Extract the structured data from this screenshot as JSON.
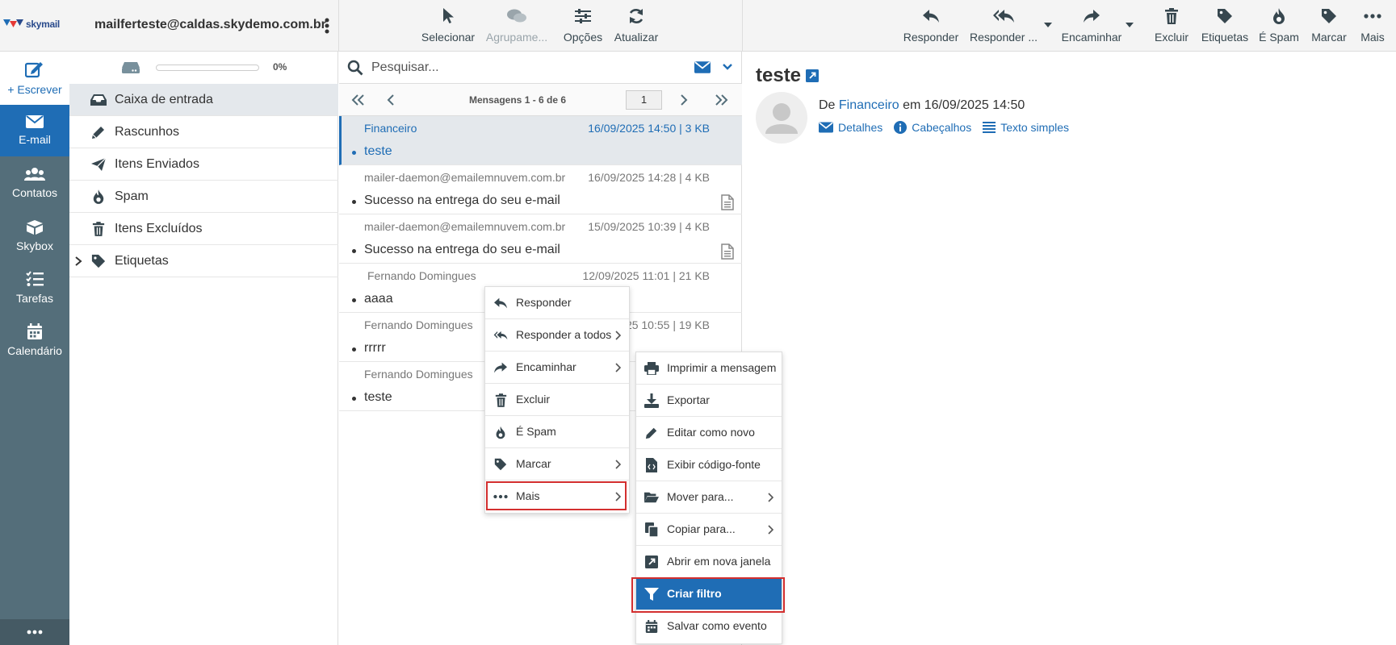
{
  "header": {
    "logo_text": "skymail",
    "account": "mailferteste@caldas.skydemo.com.br",
    "list_toolbar": {
      "select": "Selecionar",
      "group": "Agrupame...",
      "options": "Opções",
      "refresh": "Atualizar"
    },
    "message_toolbar": {
      "reply": "Responder",
      "reply_all": "Responder ...",
      "forward": "Encaminhar",
      "delete": "Excluir",
      "tags": "Etiquetas",
      "spam": "É Spam",
      "mark": "Marcar",
      "more": "Mais"
    }
  },
  "nav": {
    "compose": "+ Escrever",
    "email": "E-mail",
    "contacts": "Contatos",
    "skybox": "Skybox",
    "tasks": "Tarefas",
    "calendar": "Calendário"
  },
  "quota": {
    "percent": "0%",
    "fill": 0
  },
  "folders": [
    {
      "label": "Caixa de entrada"
    },
    {
      "label": "Rascunhos"
    },
    {
      "label": "Itens Enviados"
    },
    {
      "label": "Spam"
    },
    {
      "label": "Itens Excluídos"
    },
    {
      "label": "Etiquetas"
    }
  ],
  "search": {
    "placeholder": "Pesquisar..."
  },
  "pager": {
    "text": "Mensagens 1 - 6 de 6",
    "page": "1"
  },
  "messages": [
    {
      "from": "Financeiro",
      "date": "16/09/2025 14:50 | 3 KB",
      "subject": "teste"
    },
    {
      "from": "mailer-daemon@emailemnuvem.com.br",
      "date": "16/09/2025 14:28 | 4 KB",
      "subject": "Sucesso na entrega do seu e-mail"
    },
    {
      "from": "mailer-daemon@emailemnuvem.com.br",
      "date": "15/09/2025 10:39 | 4 KB",
      "subject": "Sucesso na entrega do seu e-mail"
    },
    {
      "from": "Fernando Domingues",
      "date": "12/09/2025 11:01 | 21 KB",
      "subject": "aaaa"
    },
    {
      "from": "Fernando Domingues",
      "date": "25 10:55 | 19 KB",
      "subject": "rrrrr"
    },
    {
      "from": "Fernando Domingues",
      "date": "",
      "subject": "teste"
    }
  ],
  "preview": {
    "title": "teste",
    "from_prefix": "De",
    "from_name": "Financeiro",
    "from_suffix": "em 16/09/2025 14:50",
    "details": "Detalhes",
    "headers": "Cabeçalhos",
    "plain": "Texto simples"
  },
  "context_menu": [
    "Responder",
    "Responder a todos",
    "Encaminhar",
    "Excluir",
    "É Spam",
    "Marcar",
    "Mais"
  ],
  "submenu": [
    "Imprimir a mensagem",
    "Exportar",
    "Editar como novo",
    "Exibir código-fonte",
    "Mover para...",
    "Copiar para...",
    "Abrir em nova janela",
    "Criar filtro",
    "Salvar como evento"
  ],
  "colors": {
    "accent": "#1f6db5",
    "nav_bg": "#546e7a",
    "highlight": "#d32f2f"
  }
}
